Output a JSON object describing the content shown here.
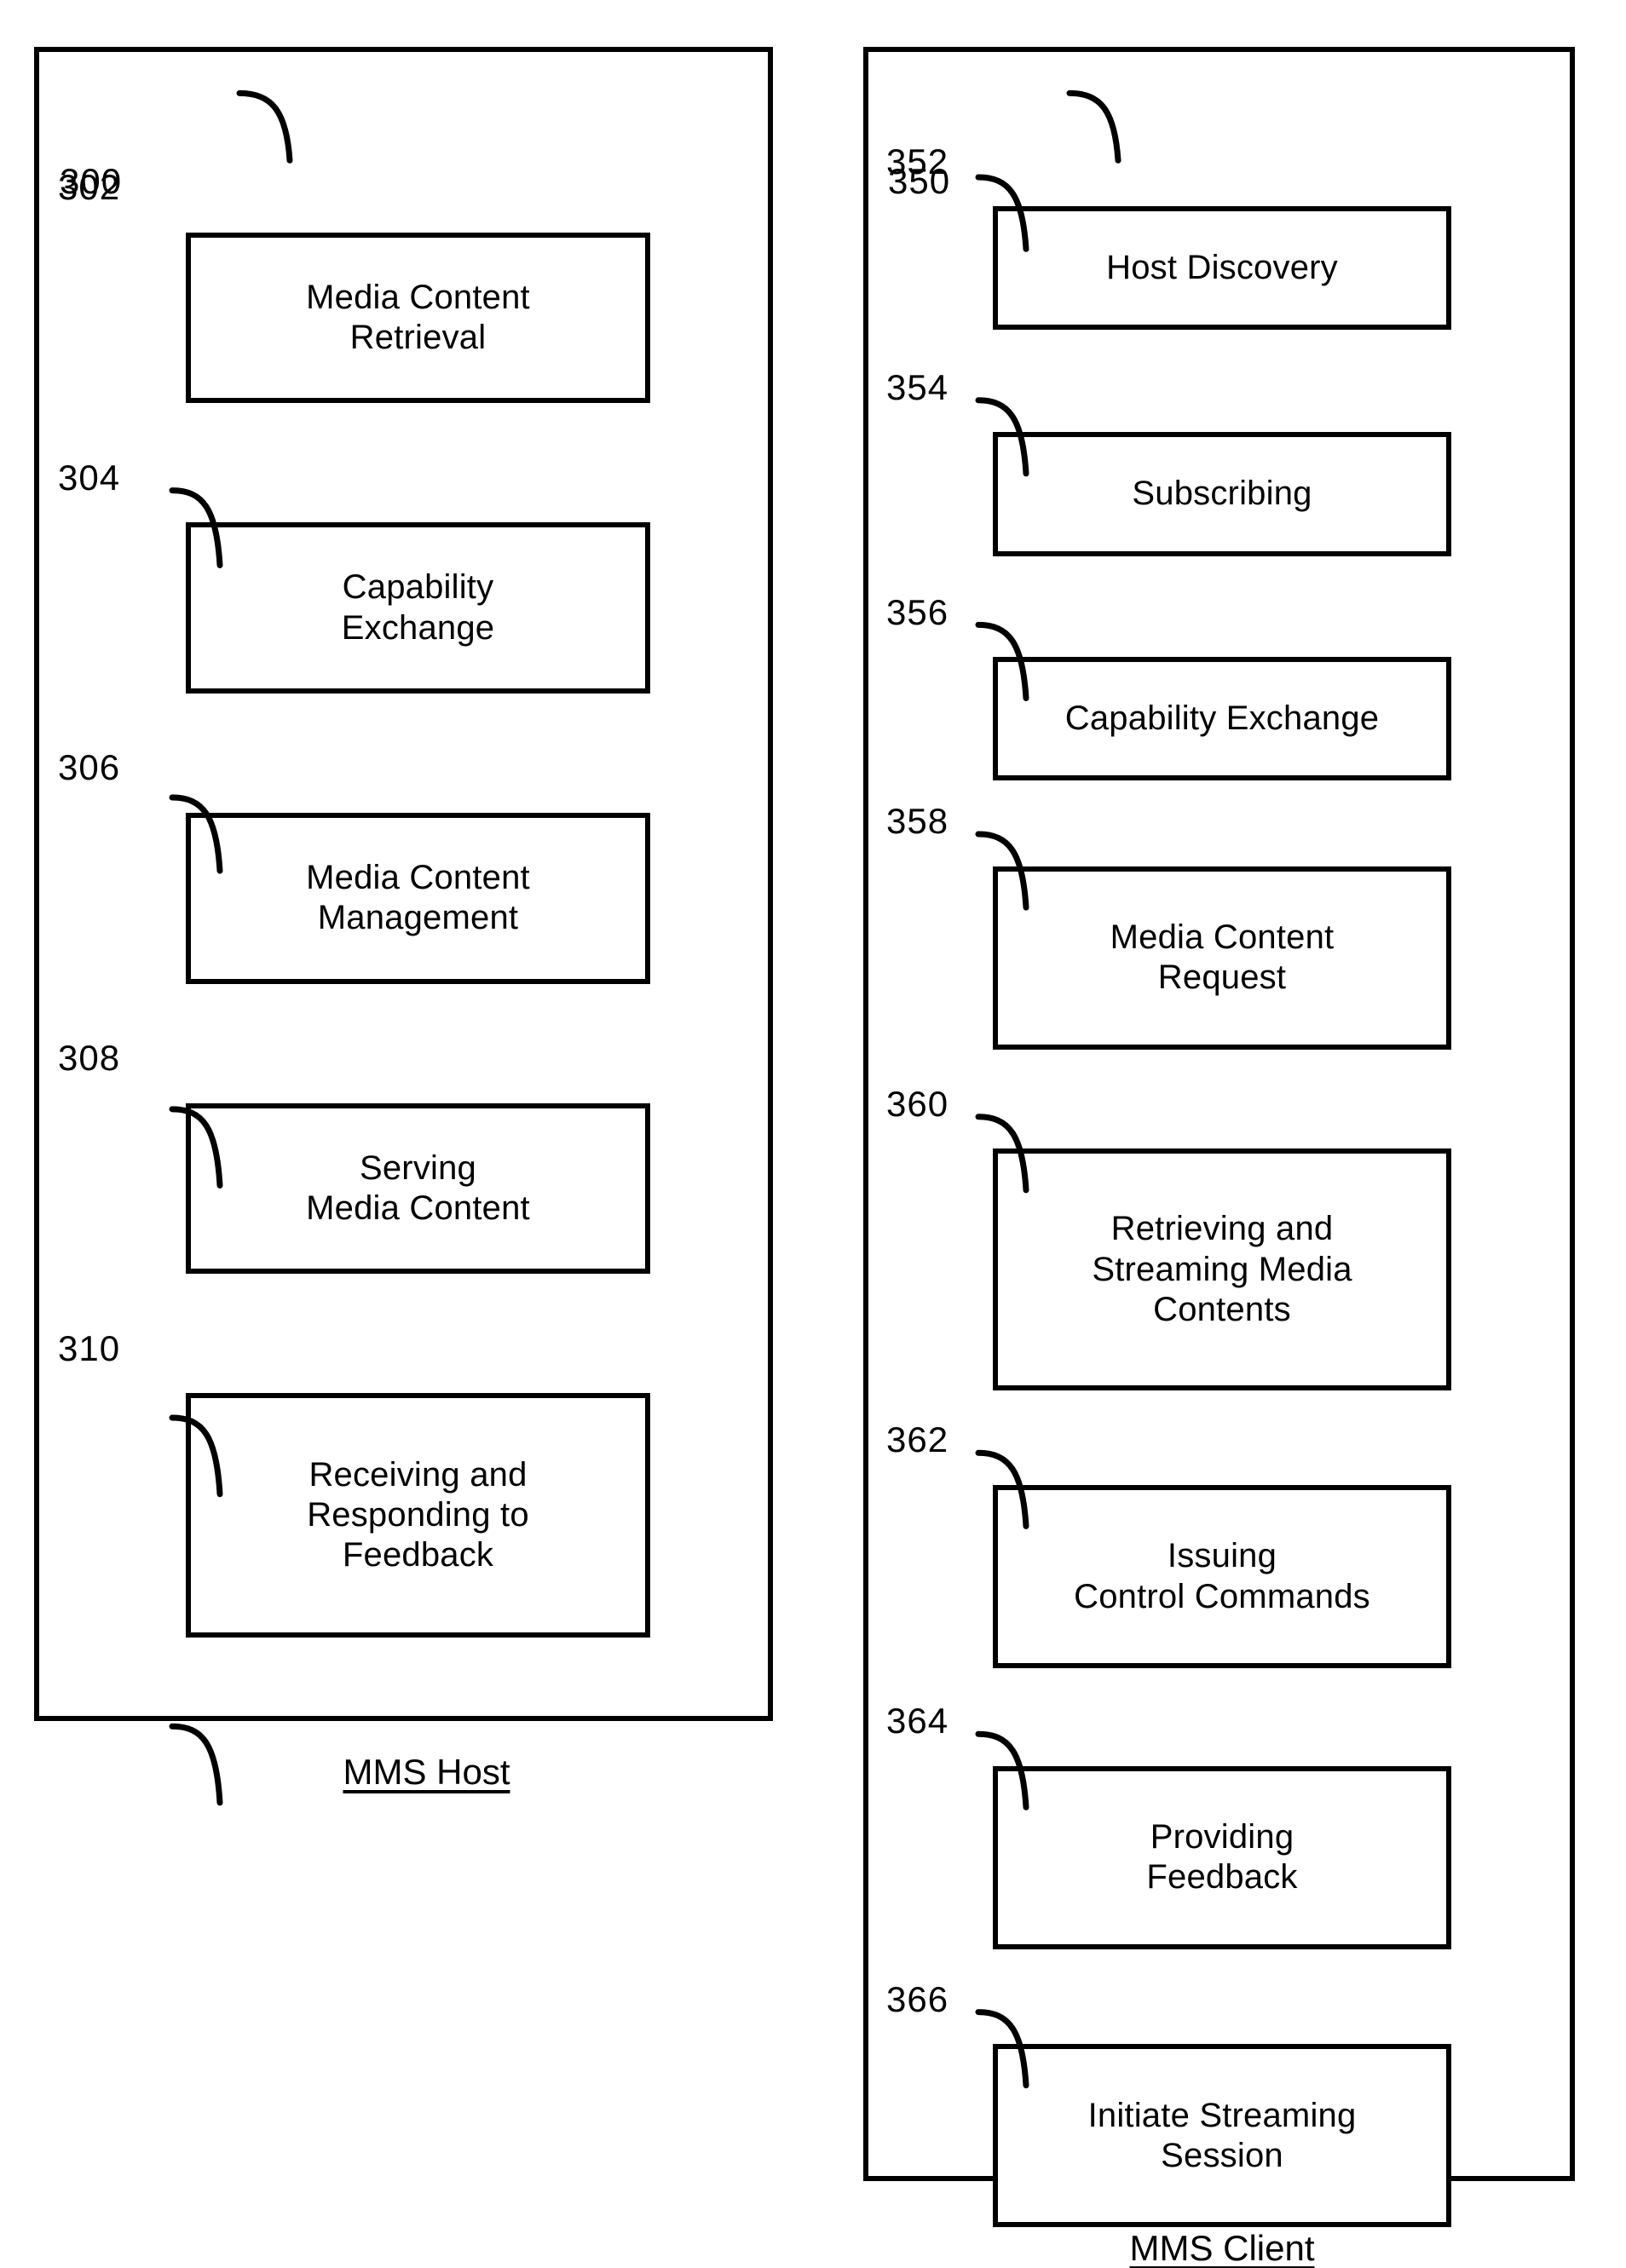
{
  "figure": {
    "host_panel": {
      "ref": "300",
      "caption": "MMS Host",
      "boxes": [
        {
          "ref": "302",
          "label": "Media Content\nRetrieval"
        },
        {
          "ref": "304",
          "label": "Capability\nExchange"
        },
        {
          "ref": "306",
          "label": "Media Content\nManagement"
        },
        {
          "ref": "308",
          "label": "Serving\nMedia Content"
        },
        {
          "ref": "310",
          "label": "Receiving and\nResponding to\nFeedback"
        }
      ]
    },
    "client_panel": {
      "ref": "350",
      "caption": "MMS Client",
      "boxes": [
        {
          "ref": "352",
          "label": "Host Discovery"
        },
        {
          "ref": "354",
          "label": "Subscribing"
        },
        {
          "ref": "356",
          "label": "Capability Exchange"
        },
        {
          "ref": "358",
          "label": "Media Content\nRequest"
        },
        {
          "ref": "360",
          "label": "Retrieving and\nStreaming Media\nContents"
        },
        {
          "ref": "362",
          "label": "Issuing\nControl Commands"
        },
        {
          "ref": "364",
          "label": "Providing\nFeedback"
        },
        {
          "ref": "366",
          "label": "Initiate Streaming\nSession"
        }
      ]
    },
    "colors": {
      "stroke": "#000000",
      "background": "#ffffff"
    }
  }
}
